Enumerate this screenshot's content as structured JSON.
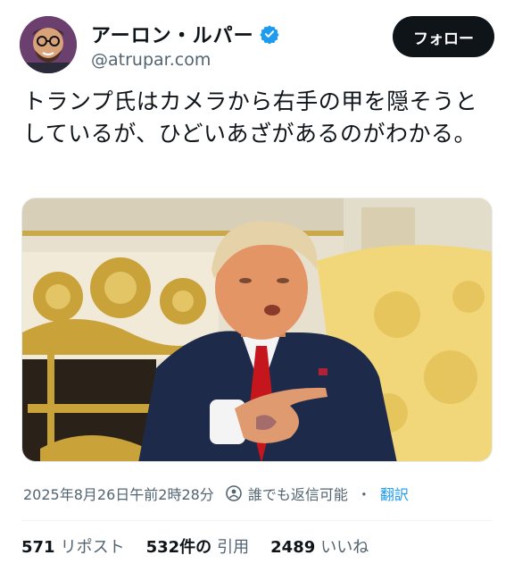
{
  "author": {
    "display_name": "アーロン・ルパー",
    "handle": "@atrupar.com",
    "verified": true
  },
  "follow_button": {
    "label": "フォロー"
  },
  "tweet": {
    "text": "トランプ氏はカメラから右手の甲を隠そうとしているが、ひどいあざがあるのがわかる。"
  },
  "meta": {
    "timestamp": "2025年8月26日午前2時28分",
    "reply_setting": "誰でも返信可能",
    "separator": "・",
    "translate_label": "翻訳"
  },
  "stats": {
    "reposts": {
      "count": "571",
      "label": "リポスト"
    },
    "quotes": {
      "count": "532件の",
      "label": "引用"
    },
    "likes": {
      "count": "2489",
      "label": "いいね"
    }
  },
  "colors": {
    "accent": "#1d9bf0",
    "follow_button_bg": "#0f1419",
    "secondary_text": "#536471"
  }
}
